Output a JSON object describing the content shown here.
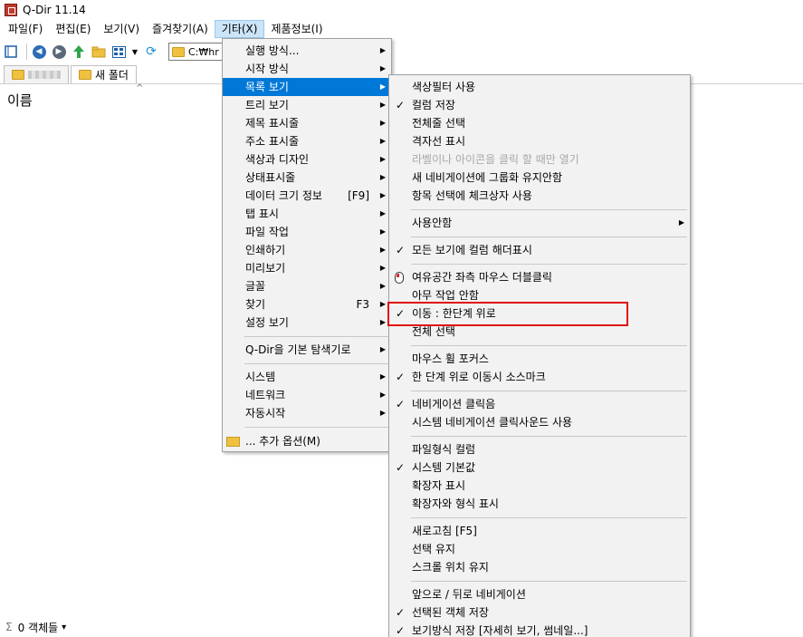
{
  "window": {
    "title": "Q-Dir 11.14"
  },
  "menubar": [
    "파일(F)",
    "편집(E)",
    "보기(V)",
    "즐겨찾기(A)",
    "기타(X)",
    "제품정보(I)"
  ],
  "toolbar": {
    "address": "C:₩hr"
  },
  "tabs": [
    "새 폴더"
  ],
  "content": {
    "column_header": "이름"
  },
  "status": {
    "sigma": "Σ",
    "count": "0 객체들",
    "arrow": "▾"
  },
  "menu1": {
    "items": [
      {
        "label": "실행 방식...",
        "arrow": "▶"
      },
      {
        "label": "시작 방식",
        "arrow": "▶"
      },
      {
        "label": "목록 보기",
        "arrow": "▶",
        "highlighted": true
      },
      {
        "label": "트리 보기",
        "arrow": "▶"
      },
      {
        "label": "제목 표시줄",
        "arrow": "▶"
      },
      {
        "label": "주소 표시줄",
        "arrow": "▶"
      },
      {
        "label": "색상과 디자인",
        "arrow": "▶"
      },
      {
        "label": "상태표시줄",
        "arrow": "▶"
      },
      {
        "label": "데이터 크기 정보",
        "shortcut": "[F9]",
        "arrow": "▶"
      },
      {
        "label": "탭 표시",
        "arrow": "▶"
      },
      {
        "label": "파일 작업",
        "arrow": "▶"
      },
      {
        "label": "인쇄하기",
        "arrow": "▶"
      },
      {
        "label": "미리보기",
        "arrow": "▶"
      },
      {
        "label": "글꼴",
        "arrow": "▶"
      },
      {
        "label": "찾기",
        "shortcut": "F3",
        "arrow": "▶"
      },
      {
        "label": "설정 보기",
        "arrow": "▶"
      },
      {
        "label": "Q-Dir을 기본 탐색기로",
        "arrow": "▶"
      },
      {
        "label": "시스템",
        "arrow": "▶"
      },
      {
        "label": "네트워크",
        "arrow": "▶"
      },
      {
        "label": "자동시작",
        "arrow": "▶"
      },
      {
        "label": "... 추가 옵션(M)"
      }
    ]
  },
  "menu2": {
    "items": [
      {
        "label": "색상필터 사용"
      },
      {
        "label": "컬럼 저장",
        "checked": "✓"
      },
      {
        "label": "전체줄 선택"
      },
      {
        "label": "격자선 표시"
      },
      {
        "label": "라벨이나 아이콘을 클릭 할 때만 열기",
        "disabled": true
      },
      {
        "label": "새 네비게이션에 그룹화 유지안함"
      },
      {
        "label": "항목 선택에 체크상자 사용"
      },
      {
        "label": "사용안함",
        "arrow": "▶"
      },
      {
        "label": "모든 보기에 컬럼 해더표시",
        "checked": "✓"
      },
      {
        "label": "여유공간 좌측 마우스 더블클릭"
      },
      {
        "label": "아무 작업 안함"
      },
      {
        "label": "이동 : 한단계 위로",
        "checked": "✓"
      },
      {
        "label": "전체 선택"
      },
      {
        "label": "마우스 휠 포커스"
      },
      {
        "label": "한 단계 위로 이동시 소스마크",
        "checked": "✓"
      },
      {
        "label": "네비게이션 클릭음",
        "checked": "✓"
      },
      {
        "label": "시스템 네비게이션 클릭사운드 사용"
      },
      {
        "label": "파일형식 컬럼"
      },
      {
        "label": "시스템 기본값",
        "checked": "✓"
      },
      {
        "label": "확장자 표시"
      },
      {
        "label": "확장자와 형식 표시"
      },
      {
        "label": "새로고침 [F5]"
      },
      {
        "label": "선택 유지"
      },
      {
        "label": "스크롤 위치 유지"
      },
      {
        "label": "앞으로 / 뒤로 네비게이션"
      },
      {
        "label": "선택된 객체 저장",
        "checked": "✓"
      },
      {
        "label": "보기방식 저장 [자세히 보기, 썸네일...]",
        "checked": "✓"
      }
    ]
  }
}
